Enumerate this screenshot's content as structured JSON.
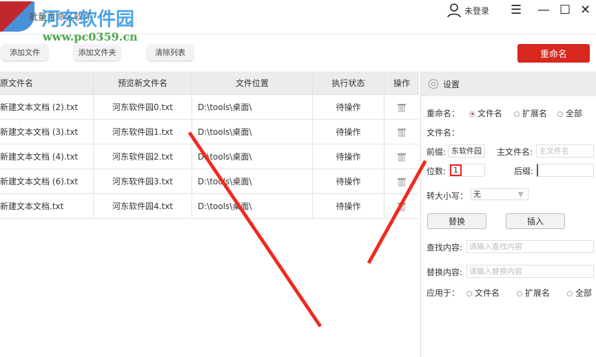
{
  "app": {
    "title": "批量重命名软件",
    "watermark_cn": "河东软件园",
    "watermark_url": "www.pc0359.cn",
    "user": "未登录"
  },
  "toolbar": {
    "add_file": "添加文件",
    "add_folder": "添加文件夹",
    "clear_list": "清除列表",
    "rename": "重命名"
  },
  "table": {
    "headers": [
      "原文件名",
      "预览新文件名",
      "文件位置",
      "执行状态",
      "操作"
    ],
    "rows": [
      [
        "新建文本文档 (2).txt",
        "河东软件园0.txt",
        "D:\\tools\\桌面\\",
        "待操作"
      ],
      [
        "新建文本文档 (3).txt",
        "河东软件园1.txt",
        "D:\\tools\\桌面\\",
        "待操作"
      ],
      [
        "新建文本文档 (4).txt",
        "河东软件园2.txt",
        "D:\\tools\\桌面\\",
        "待操作"
      ],
      [
        "新建文本文档 (6).txt",
        "河东软件园3.txt",
        "D:\\tools\\桌面\\",
        "待操作"
      ],
      [
        "新建文本文档.txt",
        "河东软件园4.txt",
        "D:\\tools\\桌面\\",
        "待操作"
      ]
    ]
  },
  "settings": {
    "title": "设置",
    "rename_label": "重命名：",
    "opt_filename": "文件名",
    "opt_ext": "扩展名",
    "opt_all": "全部",
    "filename_label": "文件名：",
    "prefix_label": "前缀:",
    "prefix_value": "东软件园",
    "main_label": "主文件名:",
    "main_placeholder": "主文件名",
    "digits_label": "位数:",
    "digits_value": "1",
    "suffix_label": "后缀:",
    "case_label": "转大小写：",
    "case_value": "无",
    "replace_btn": "替换",
    "insert_btn": "插入",
    "find_label": "查找内容:",
    "find_placeholder": "请输入查找内容",
    "replace_label": "替换内容:",
    "replace_placeholder": "请输入替换内容",
    "apply_label": "应用于：",
    "apply_filename": "文件名",
    "apply_ext": "扩展名",
    "apply_all": "全部"
  },
  "colors": {
    "accent": "#d7271f"
  }
}
